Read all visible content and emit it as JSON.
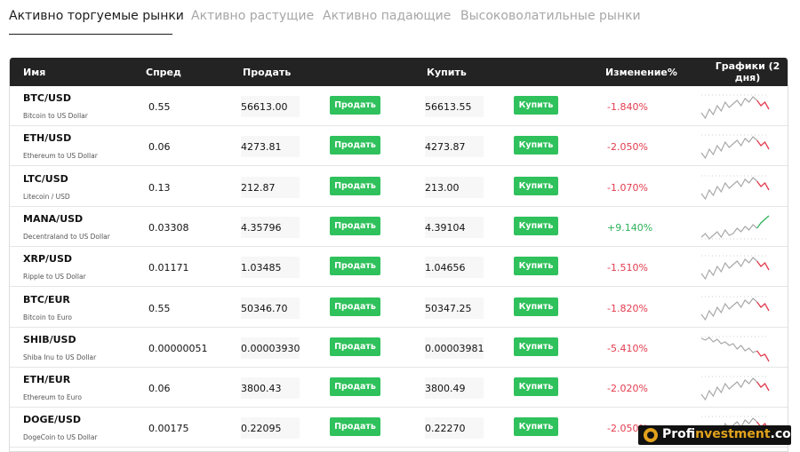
{
  "tabs": [
    {
      "label": "Активно торгуемые рынки",
      "active": true
    },
    {
      "label": "Активно растущие",
      "active": false
    },
    {
      "label": "Активно падающие",
      "active": false
    },
    {
      "label": "Высоковолатильные рынки",
      "active": false
    }
  ],
  "columns": {
    "name": "Имя",
    "spread": "Спред",
    "sell": "Продать",
    "buy": "Купить",
    "change": "Изменение%",
    "chart": "Графики (2 дня)"
  },
  "buttons": {
    "sell": "Продать",
    "buy": "Купить"
  },
  "colors": {
    "buy_button": "#2fc15c",
    "negative": "#e33b4d",
    "positive": "#2fb25a",
    "header": "#232323",
    "sparkline_base": "#a8a8a8"
  },
  "rows": [
    {
      "symbol": "BTC/USD",
      "name": "Bitcoin to US Dollar",
      "spread": "0.55",
      "sell": "56613.00",
      "buy": "56613.55",
      "change": "-1.840%",
      "direction": "neg"
    },
    {
      "symbol": "ETH/USD",
      "name": "Ethereum to US Dollar",
      "spread": "0.06",
      "sell": "4273.81",
      "buy": "4273.87",
      "change": "-2.050%",
      "direction": "neg"
    },
    {
      "symbol": "LTC/USD",
      "name": "Litecoin / USD",
      "spread": "0.13",
      "sell": "212.87",
      "buy": "213.00",
      "change": "-1.070%",
      "direction": "neg"
    },
    {
      "symbol": "MANA/USD",
      "name": "Decentraland to US Dollar",
      "spread": "0.03308",
      "sell": "4.35796",
      "buy": "4.39104",
      "change": "+9.140%",
      "direction": "pos"
    },
    {
      "symbol": "XRP/USD",
      "name": "Ripple to US Dollar",
      "spread": "0.01171",
      "sell": "1.03485",
      "buy": "1.04656",
      "change": "-1.510%",
      "direction": "neg"
    },
    {
      "symbol": "BTC/EUR",
      "name": "Bitcoin to Euro",
      "spread": "0.55",
      "sell": "50346.70",
      "buy": "50347.25",
      "change": "-1.820%",
      "direction": "neg"
    },
    {
      "symbol": "SHIB/USD",
      "name": "Shiba Inu to US Dollar",
      "spread": "0.00000051",
      "sell": "0.00003930",
      "buy": "0.00003981",
      "change": "-5.410%",
      "direction": "neg"
    },
    {
      "symbol": "ETH/EUR",
      "name": "Ethereum to Euro",
      "spread": "0.06",
      "sell": "3800.43",
      "buy": "3800.49",
      "change": "-2.020%",
      "direction": "neg"
    },
    {
      "symbol": "DOGE/USD",
      "name": "DogeCoin to US Dollar",
      "spread": "0.00175",
      "sell": "0.22095",
      "buy": "0.22270",
      "change": "-2.050%",
      "direction": "neg"
    }
  ],
  "watermark": {
    "prefix": "Prof",
    "accent": "investment",
    "suffix": ".com"
  }
}
